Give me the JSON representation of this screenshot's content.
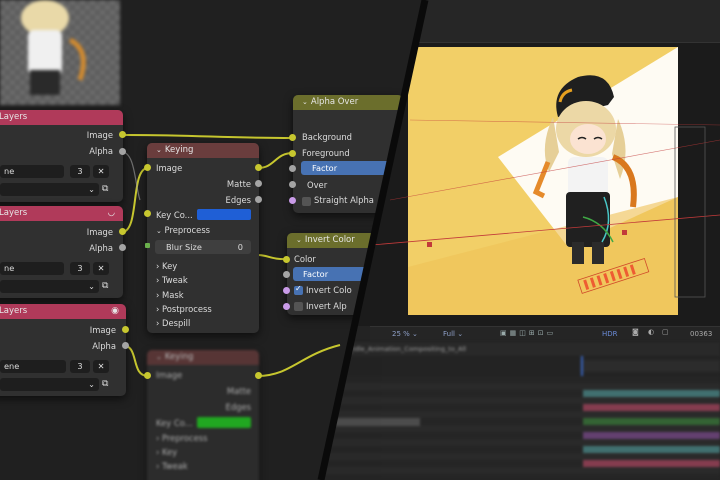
{
  "left_nodes": {
    "layers_node_1": {
      "title": "Layers",
      "scene_label": "ne",
      "number": "3",
      "out_image": "Image",
      "out_alpha": "Alpha"
    },
    "layers_node_2": {
      "title": "Layers",
      "scene_label": "ne",
      "number": "3",
      "out_image": "Image",
      "out_alpha": "Alpha"
    },
    "layers_node_3": {
      "title": "Layers",
      "scene_label": "ene",
      "number": "3",
      "out_image": "Image",
      "out_alpha": "Alpha"
    },
    "close_glyph": "✕"
  },
  "keying_node_1": {
    "title": "Keying",
    "in_image": "Image",
    "out_matte": "Matte",
    "out_edges": "Edges",
    "key_color_label": "Key Co...",
    "key_color": "#1f5fd6",
    "preprocess_label": "Preprocess",
    "blur_size_label": "Blur Size",
    "blur_size_value": "0",
    "panels": [
      "Key",
      "Tweak",
      "Mask",
      "Postprocess",
      "Despill"
    ]
  },
  "keying_node_2": {
    "title": "Keying",
    "in_image": "Image",
    "out_matte": "Matte",
    "out_edges": "Edges",
    "key_color_label": "Key Co...",
    "key_color": "#22d422",
    "panels": [
      "Preprocess",
      "Key",
      "Tweak"
    ]
  },
  "alpha_over_node": {
    "title": "Alpha Over",
    "in_background": "Background",
    "in_foreground": "Foreground",
    "factor_label": "Factor",
    "mode_value": "Over",
    "straight_alpha_label": "Straight Alpha"
  },
  "invert_color_node": {
    "title": "Invert Color",
    "in_color": "Color",
    "factor_label": "Factor",
    "invert_color_label": "Invert Colo",
    "invert_alpha_label": "Invert Alp"
  },
  "ae": {
    "zoom": "25",
    "zoom_unit": "%",
    "resolution": "Full",
    "timecode": "00363",
    "comp_tab": "Show_Idle_Animation_Compositing_to_All",
    "hdr_label": "HDR"
  },
  "colors": {
    "layers_header": "#b03a5a",
    "keying_header": "#6a3d3d",
    "alpha_over_header": "#6b6e2c",
    "wire_yellow": "#c7c72f",
    "wire_gray": "#a4a4a4",
    "factor_blue": "#4772b3",
    "canvas_yellow": "#f2cf67"
  }
}
